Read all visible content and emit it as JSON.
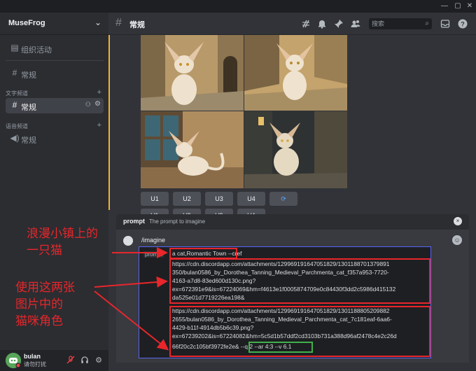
{
  "titlebar": {
    "controls": [
      "—",
      "▢",
      "✕"
    ]
  },
  "server": {
    "name": "MuseFrog"
  },
  "sidebar": {
    "events_label": "组织活动",
    "top_channel": "常规",
    "text_category": "文字频道",
    "text_channels": [
      {
        "label": "常规"
      }
    ],
    "voice_category": "语音频道",
    "voice_channels": [
      {
        "label": "常规"
      }
    ]
  },
  "user": {
    "name": "bulan",
    "status": "请勿打扰"
  },
  "header": {
    "channel_name": "常规",
    "search_placeholder": "搜索"
  },
  "upscale_buttons": [
    "U1",
    "U2",
    "U3",
    "U4"
  ],
  "variation_buttons": [
    "V1",
    "V2",
    "V3",
    "V4"
  ],
  "popup": {
    "keyword": "prompt",
    "description": "The prompt to imagine"
  },
  "composer": {
    "command": "/imagine",
    "param_label": "prompt",
    "lines": [
      "a cat,Romantic Town  --cref",
      "https://cdn.discordapp.com/attachments/1299691916470518​29/1301188701379891",
      "350/bulan0586_by_Dorothea_Tanning_Medieval_Parchmenta_cat_f357a953-7720-",
      "4163-a7d8-83ed600d130c.png?",
      "ex=672391e9&is=67224069&hm=f4613e1f0005874709e0c84430f3dd2c5986d415132",
      "da525e01d7719226ea198&",
      "https://cdn.discordapp.com/attachments/1299691916470518​29/1301188805209882",
      "2655/bulan0586_by_Dorothea_Tanning_Medieval_Parchmenta_cat_7c181eaf-6aa6-",
      "4429-b11f-4914db5b6c39.png?",
      "ex=67239202&is=67224082&hm=5c5d1b57ddf2cd3103b731a388d96af2478c4e2c26d",
      "66f20c2c105bf3972fe2e&  --q 2 --ar 4:3 --v 6.1"
    ]
  },
  "annotations": {
    "town_cat": [
      "浪漫小镇上的",
      "一只猫"
    ],
    "use_images": [
      "使用这两张",
      "图片中的",
      "猫咪角色"
    ]
  },
  "colors": {
    "annotation_red": "#e8262b",
    "params_green": "#3fb24a",
    "accent_yellow": "#f0b232"
  }
}
